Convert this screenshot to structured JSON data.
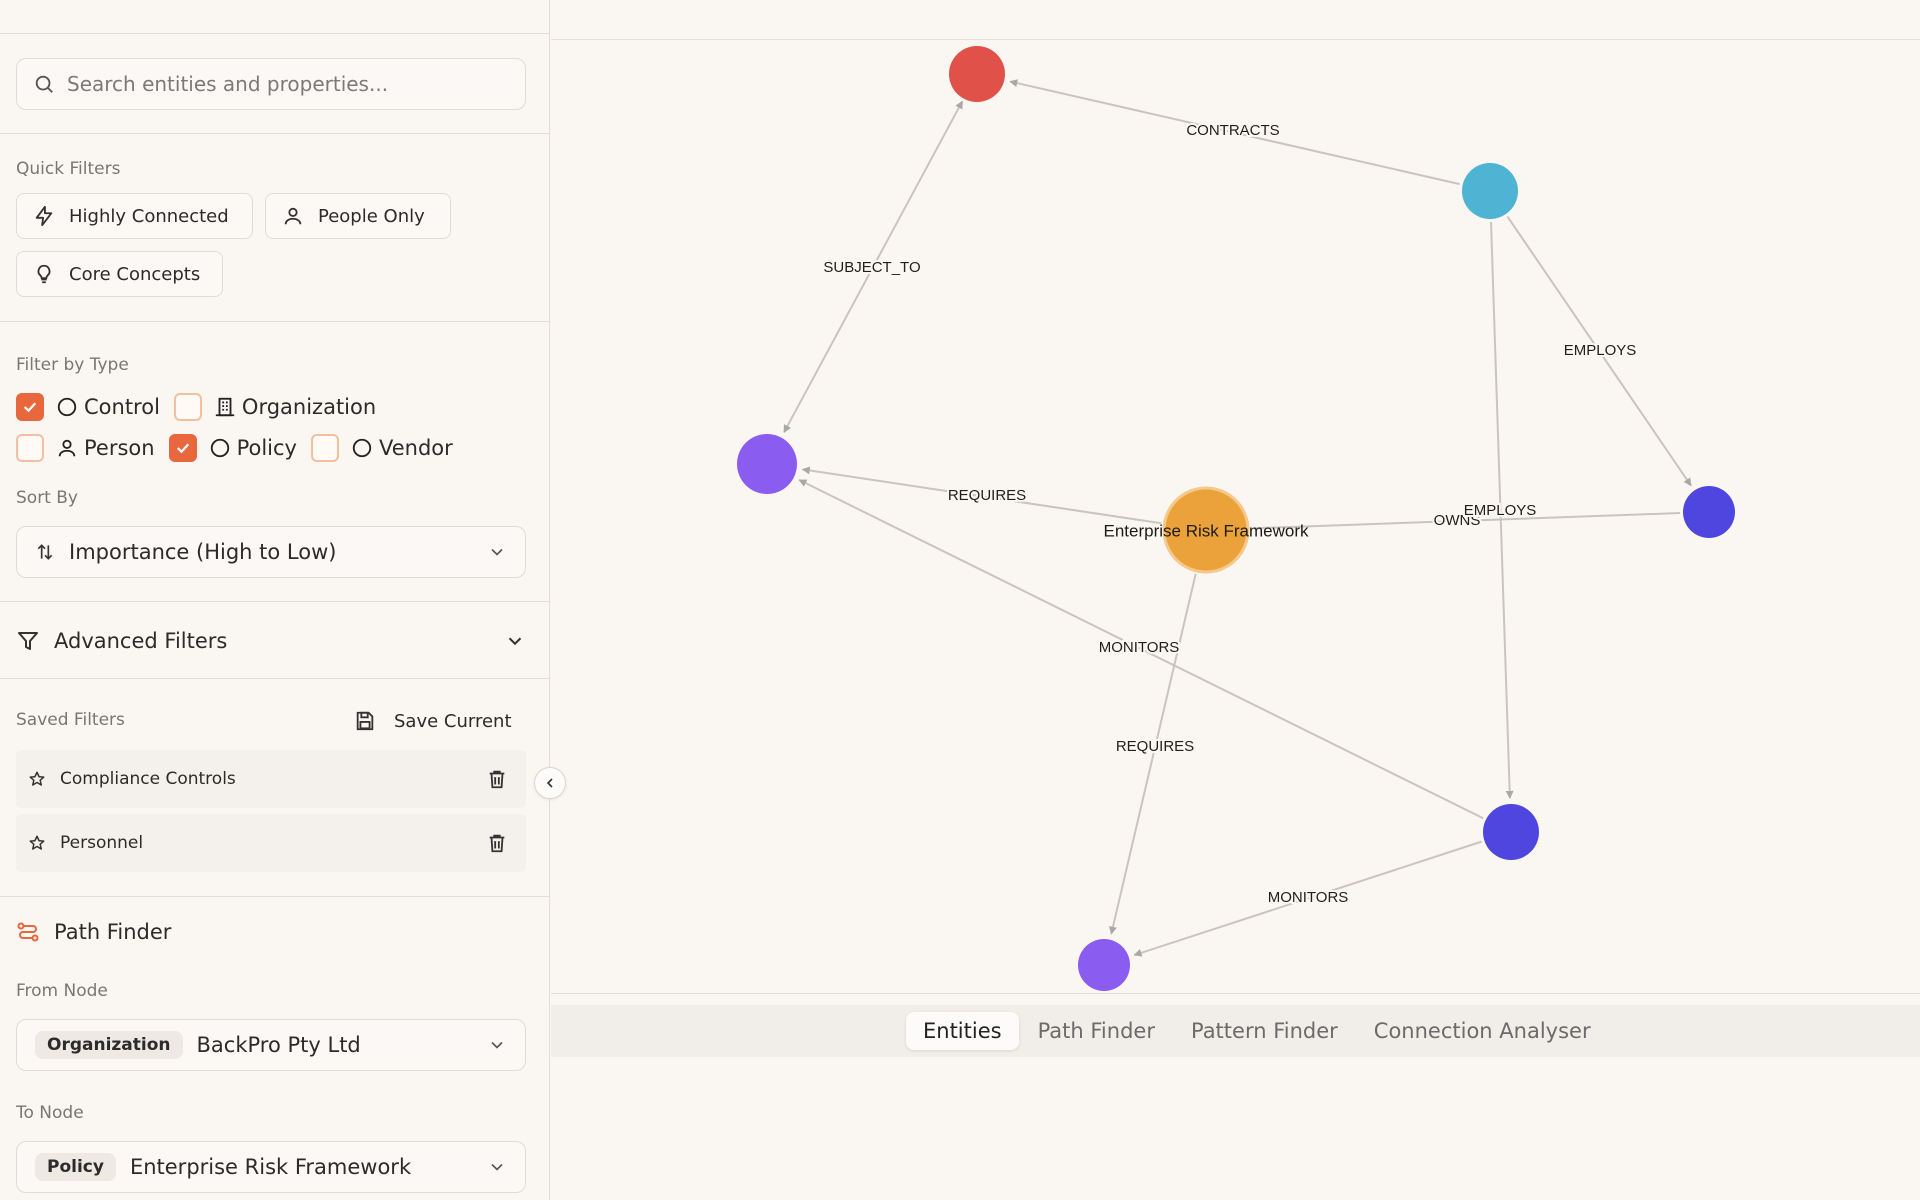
{
  "search": {
    "placeholder": "Search entities and properties..."
  },
  "quick_filters": {
    "title": "Quick Filters",
    "items": [
      {
        "label": "Highly Connected",
        "icon": "lightning-icon"
      },
      {
        "label": "People Only",
        "icon": "person-icon"
      },
      {
        "label": "Core Concepts",
        "icon": "lightbulb-icon"
      }
    ]
  },
  "filter_by_type": {
    "title": "Filter by Type",
    "types": [
      {
        "label": "Control",
        "checked": true,
        "icon": "circle-icon"
      },
      {
        "label": "Organization",
        "checked": false,
        "icon": "building-icon"
      },
      {
        "label": "Person",
        "checked": false,
        "icon": "person-icon"
      },
      {
        "label": "Policy",
        "checked": true,
        "icon": "circle-icon"
      },
      {
        "label": "Vendor",
        "checked": false,
        "icon": "circle-icon"
      }
    ]
  },
  "sort_by": {
    "title": "Sort By",
    "value": "Importance (High to Low)"
  },
  "advanced_filters": {
    "label": "Advanced Filters"
  },
  "saved_filters": {
    "title": "Saved Filters",
    "save_label": "Save Current",
    "items": [
      {
        "label": "Compliance Controls"
      },
      {
        "label": "Personnel"
      }
    ]
  },
  "path_finder": {
    "title": "Path Finder",
    "from_label": "From Node",
    "from": {
      "type": "Organization",
      "value": "BackPro Pty Ltd"
    },
    "to_label": "To Node",
    "to": {
      "type": "Policy",
      "value": "Enterprise Risk Framework"
    }
  },
  "graph": {
    "nodes": [
      {
        "id": "red",
        "label": "",
        "color": "#e05149"
      },
      {
        "id": "teal",
        "label": "",
        "color": "#4fb3d3"
      },
      {
        "id": "purple-left",
        "label": "",
        "color": "#8b5cf0"
      },
      {
        "id": "center",
        "label": "Enterprise Risk Framework",
        "color": "#eba23a"
      },
      {
        "id": "indigo-right",
        "label": "",
        "color": "#4f46e0"
      },
      {
        "id": "indigo-bottom",
        "label": "",
        "color": "#4f46e0"
      },
      {
        "id": "purple-bottom",
        "label": "",
        "color": "#8b5cf0"
      }
    ],
    "edges": [
      {
        "label": "CONTRACTS"
      },
      {
        "label": "SUBJECT_TO"
      },
      {
        "label": "EMPLOYS"
      },
      {
        "label": "REQUIRES"
      },
      {
        "label": "OWNS"
      },
      {
        "label": "EMPLOYS"
      },
      {
        "label": "MONITORS"
      },
      {
        "label": "REQUIRES"
      },
      {
        "label": "MONITORS"
      }
    ]
  },
  "tabs": [
    {
      "label": "Entities",
      "active": true
    },
    {
      "label": "Path Finder",
      "active": false
    },
    {
      "label": "Pattern Finder",
      "active": false
    },
    {
      "label": "Connection Analyser",
      "active": false
    }
  ]
}
